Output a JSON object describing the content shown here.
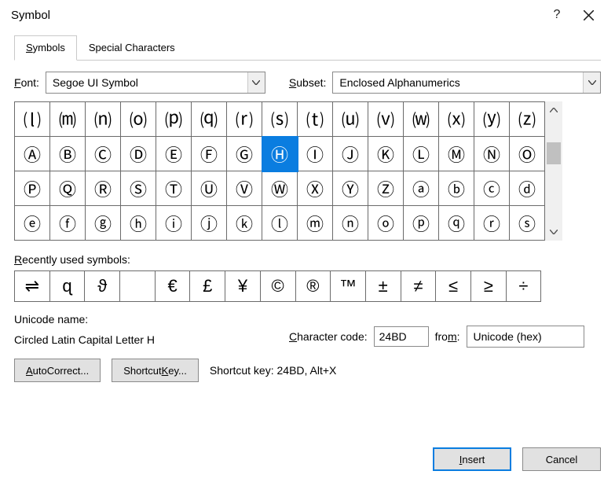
{
  "title": "Symbol",
  "tabs": {
    "symbols": "Symbols",
    "special": "Special Characters"
  },
  "font_label_pre": "F",
  "font_label_post": "ont:",
  "font_value": "Segoe UI Symbol",
  "subset_label_pre": "S",
  "subset_label_post": "ubset:",
  "subset_value": "Enclosed Alphanumerics",
  "grid": [
    [
      "⒧",
      "⒨",
      "⒩",
      "⒪",
      "⒫",
      "⒬",
      "⒭",
      "⒮",
      "⒯",
      "⒰",
      "⒱",
      "⒲",
      "⒳",
      "⒴",
      "⒵"
    ],
    [
      "Ⓐ",
      "Ⓑ",
      "Ⓒ",
      "Ⓓ",
      "Ⓔ",
      "Ⓕ",
      "Ⓖ",
      "Ⓗ",
      "Ⓘ",
      "Ⓙ",
      "Ⓚ",
      "Ⓛ",
      "Ⓜ",
      "Ⓝ",
      "Ⓞ"
    ],
    [
      "Ⓟ",
      "Ⓠ",
      "Ⓡ",
      "Ⓢ",
      "Ⓣ",
      "Ⓤ",
      "Ⓥ",
      "Ⓦ",
      "Ⓧ",
      "Ⓨ",
      "Ⓩ",
      "ⓐ",
      "ⓑ",
      "ⓒ",
      "ⓓ"
    ],
    [
      "ⓔ",
      "ⓕ",
      "ⓖ",
      "ⓗ",
      "ⓘ",
      "ⓙ",
      "ⓚ",
      "ⓛ",
      "ⓜ",
      "ⓝ",
      "ⓞ",
      "ⓟ",
      "ⓠ",
      "ⓡ",
      "ⓢ"
    ]
  ],
  "selected_row": 1,
  "selected_col": 7,
  "recent_label": "Recently used symbols:",
  "recent": [
    "⇌",
    "ɋ",
    "ϑ",
    "",
    "€",
    "£",
    "¥",
    "©",
    "®",
    "™",
    "±",
    "≠",
    "≤",
    "≥",
    "÷"
  ],
  "unicode_name_label": "Unicode name:",
  "unicode_name_value": "Circled Latin Capital Letter H",
  "char_code_label_pre": "C",
  "char_code_label_post": "haracter code:",
  "char_code_value": "24BD",
  "from_label": "from:",
  "from_value": "Unicode (hex)",
  "autocorrect_label": "AutoCorrect...",
  "shortcut_btn_label": "Shortcut Key...",
  "shortcut_text": "Shortcut key: 24BD, Alt+X",
  "insert_label": "Insert",
  "cancel_label": "Cancel"
}
